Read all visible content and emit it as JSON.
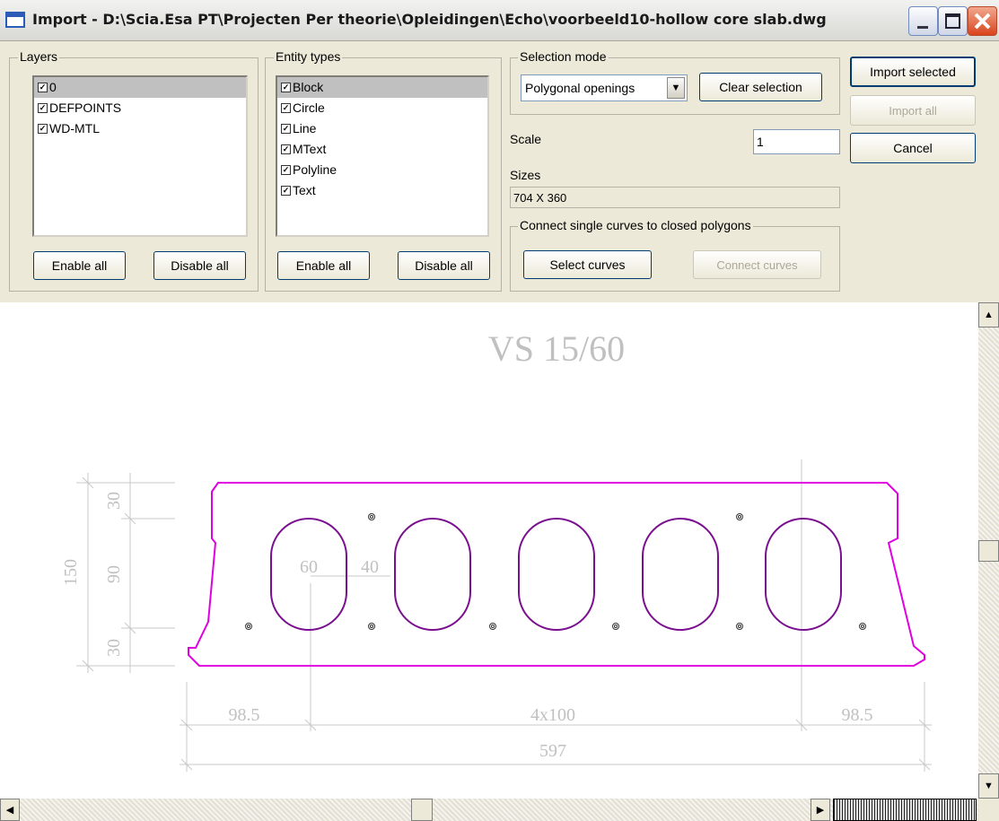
{
  "window": {
    "title": "Import - D:\\Scia.Esa PT\\Projecten Per theorie\\Opleidingen\\Echo\\voorbeeld10-hollow core slab.dwg"
  },
  "layers": {
    "label": "Layers",
    "items": [
      {
        "name": "0",
        "checked": true
      },
      {
        "name": "DEFPOINTS",
        "checked": true
      },
      {
        "name": "WD-MTL",
        "checked": true
      }
    ],
    "enable_all": "Enable all",
    "disable_all": "Disable all"
  },
  "entity_types": {
    "label": "Entity types",
    "items": [
      {
        "name": "Block",
        "checked": true
      },
      {
        "name": "Circle",
        "checked": true
      },
      {
        "name": "Line",
        "checked": true
      },
      {
        "name": "MText",
        "checked": true
      },
      {
        "name": "Polyline",
        "checked": true
      },
      {
        "name": "Text",
        "checked": true
      }
    ],
    "enable_all": "Enable all",
    "disable_all": "Disable all"
  },
  "selection_mode": {
    "label": "Selection mode",
    "value": "Polygonal openings",
    "clear_selection": "Clear selection"
  },
  "scale": {
    "label": "Scale",
    "value": "1"
  },
  "sizes": {
    "label": "Sizes",
    "value": "704 X 360"
  },
  "connect": {
    "label": "Connect single curves to closed polygons",
    "select_curves": "Select curves",
    "connect_curves": "Connect curves"
  },
  "actions": {
    "import_selected": "Import selected",
    "import_all": "Import all",
    "cancel": "Cancel"
  },
  "drawing": {
    "title": "VS 15/60",
    "dim_height_total": "150",
    "dim_top": "30",
    "dim_mid": "90",
    "dim_bottom": "30",
    "dim_hole_width": "60",
    "dim_web": "40",
    "dim_left": "98.5",
    "dim_center": "4x100",
    "dim_right": "98.5",
    "dim_total": "597",
    "colors": {
      "outline": "#e000e0",
      "holes": "#7a1090",
      "dims": "#c0c0c0"
    }
  }
}
